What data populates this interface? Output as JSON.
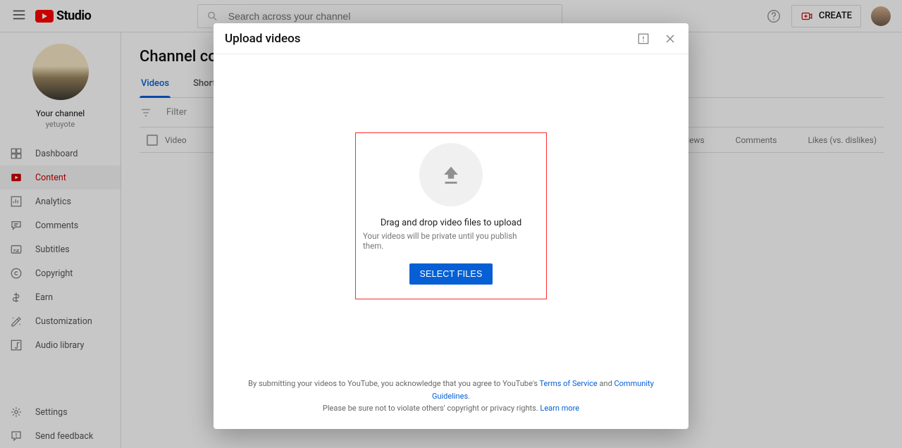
{
  "header": {
    "logo_text": "Studio",
    "search_placeholder": "Search across your channel",
    "create_label": "CREATE"
  },
  "sidebar": {
    "channel_title": "Your channel",
    "channel_name": "yetuyote",
    "items": [
      {
        "label": "Dashboard"
      },
      {
        "label": "Content"
      },
      {
        "label": "Analytics"
      },
      {
        "label": "Comments"
      },
      {
        "label": "Subtitles"
      },
      {
        "label": "Copyright"
      },
      {
        "label": "Earn"
      },
      {
        "label": "Customization"
      },
      {
        "label": "Audio library"
      }
    ],
    "footer": [
      {
        "label": "Settings"
      },
      {
        "label": "Send feedback"
      }
    ]
  },
  "main": {
    "title": "Channel content",
    "tabs": [
      {
        "label": "Videos",
        "active": true
      },
      {
        "label": "Shorts"
      }
    ],
    "filter_placeholder": "Filter",
    "columns": {
      "video": "Video",
      "views": "Views",
      "comments": "Comments",
      "likes": "Likes (vs. dislikes)"
    }
  },
  "dialog": {
    "title": "Upload videos",
    "drop_title": "Drag and drop video files to upload",
    "drop_sub": "Your videos will be private until you publish them.",
    "select_label": "SELECT FILES",
    "foot_prefix": "By submitting your videos to YouTube, you acknowledge that you agree to YouTube's ",
    "tos": "Terms of Service",
    "and": " and ",
    "guidelines": "Community Guidelines",
    "period": ".",
    "foot_line2_a": "Please be sure not to violate others' copyright or privacy rights. ",
    "learn": "Learn more"
  }
}
